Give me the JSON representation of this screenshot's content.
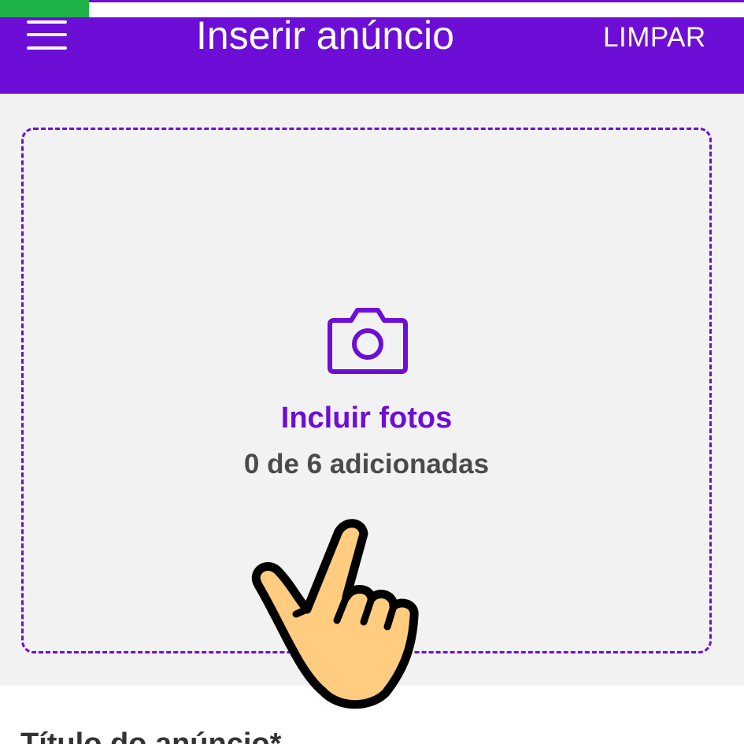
{
  "app_bar": {
    "title": "Inserir anúncio",
    "clear_label": "LIMPAR",
    "menu_icon": "hamburger-menu-icon"
  },
  "photos": {
    "icon": "camera-icon",
    "label": "Incluir fotos",
    "count_text": "0 de 6 adicionadas"
  },
  "form": {
    "title_label": "Título do anúncio*"
  },
  "overlay": {
    "icon": "pointing-hand-icon"
  },
  "colors": {
    "accent": "#6d0ed6",
    "progress": "#1fb24a",
    "section_bg": "#f2f2f2",
    "hand_fill": "#ffcc80"
  }
}
